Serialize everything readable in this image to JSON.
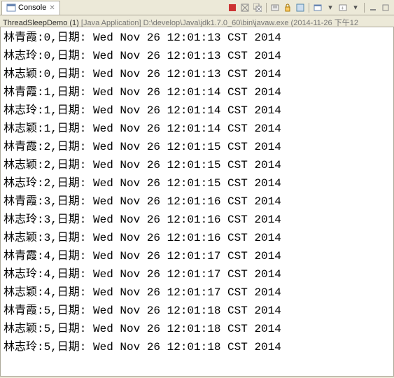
{
  "tab": {
    "label": "Console"
  },
  "runInfo": {
    "title": "ThreadSleepDemo (1)",
    "detail": "[Java Application] D:\\develop\\Java\\jdk1.7.0_60\\bin\\javaw.exe (2014-11-26 下午12"
  },
  "lines": [
    "林青霞:0,日期: Wed Nov 26 12:01:13 CST 2014",
    "林志玲:0,日期: Wed Nov 26 12:01:13 CST 2014",
    "林志颖:0,日期: Wed Nov 26 12:01:13 CST 2014",
    "林青霞:1,日期: Wed Nov 26 12:01:14 CST 2014",
    "林志玲:1,日期: Wed Nov 26 12:01:14 CST 2014",
    "林志颖:1,日期: Wed Nov 26 12:01:14 CST 2014",
    "林青霞:2,日期: Wed Nov 26 12:01:15 CST 2014",
    "林志颖:2,日期: Wed Nov 26 12:01:15 CST 2014",
    "林志玲:2,日期: Wed Nov 26 12:01:15 CST 2014",
    "林青霞:3,日期: Wed Nov 26 12:01:16 CST 2014",
    "林志玲:3,日期: Wed Nov 26 12:01:16 CST 2014",
    "林志颖:3,日期: Wed Nov 26 12:01:16 CST 2014",
    "林青霞:4,日期: Wed Nov 26 12:01:17 CST 2014",
    "林志玲:4,日期: Wed Nov 26 12:01:17 CST 2014",
    "林志颖:4,日期: Wed Nov 26 12:01:17 CST 2014",
    "林青霞:5,日期: Wed Nov 26 12:01:18 CST 2014",
    "林志颖:5,日期: Wed Nov 26 12:01:18 CST 2014",
    "林志玲:5,日期: Wed Nov 26 12:01:18 CST 2014"
  ]
}
